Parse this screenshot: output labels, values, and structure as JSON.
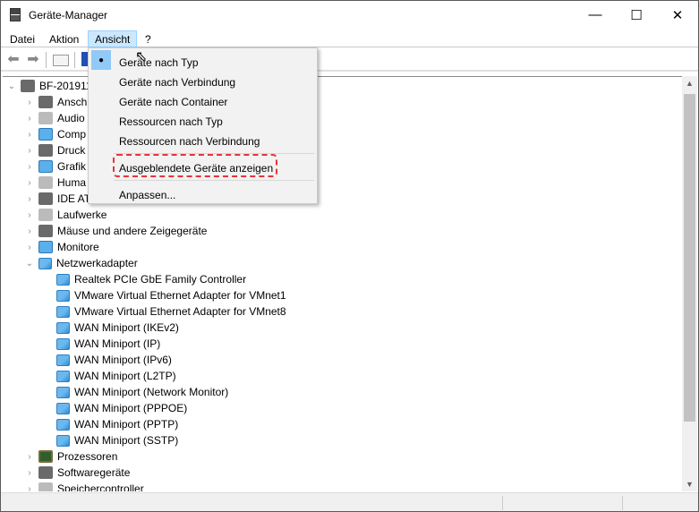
{
  "window": {
    "title": "Geräte-Manager"
  },
  "menubar": [
    "Datei",
    "Aktion",
    "Ansicht",
    "?"
  ],
  "view_menu": {
    "items": [
      "Geräte nach Typ",
      "Geräte nach Verbindung",
      "Geräte nach Container",
      "Ressourcen nach Typ",
      "Ressourcen nach Verbindung",
      "Ausgeblendete Geräte anzeigen",
      "Anpassen..."
    ],
    "checked": "Geräte nach Typ",
    "highlighted": "Ausgeblendete Geräte anzeigen"
  },
  "tree": {
    "root": "BF-201911",
    "categories_top": [
      "Anschl",
      "Audio",
      "Comp",
      "Druck",
      "Grafik",
      "Huma",
      "IDE AT",
      "Laufwerke",
      "Mäuse und andere Zeigegeräte",
      "Monitore",
      "Netzwerkadapter"
    ],
    "network_adapters": [
      "Realtek PCIe GbE Family Controller",
      "VMware Virtual Ethernet Adapter for VMnet1",
      "VMware Virtual Ethernet Adapter for VMnet8",
      "WAN Miniport (IKEv2)",
      "WAN Miniport (IP)",
      "WAN Miniport (IPv6)",
      "WAN Miniport (L2TP)",
      "WAN Miniport (Network Monitor)",
      "WAN Miniport (PPPOE)",
      "WAN Miniport (PPTP)",
      "WAN Miniport (SSTP)"
    ],
    "categories_bottom": [
      "Prozessoren",
      "Softwaregeräte",
      "Speichercontroller"
    ]
  },
  "colors": {
    "highlight": "#e8323c",
    "menu_active": "#cce8ff"
  }
}
